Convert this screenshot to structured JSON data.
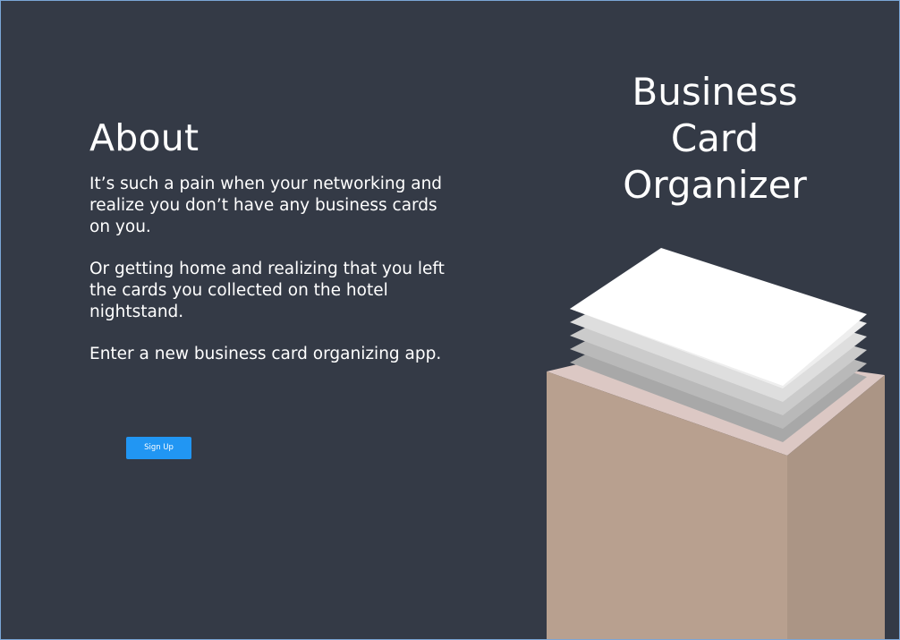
{
  "about": {
    "heading": "About",
    "paragraphs": [
      "It’s such a pain when your networking and realize you don’t have any business cards on you.",
      "Or getting home and realizing that you left the cards you collected on the hotel nightstand.",
      "Enter a new business card organizing app."
    ]
  },
  "actions": {
    "signup_label": "Sign Up"
  },
  "hero": {
    "title_lines": [
      "Business",
      "Card",
      "Organizer"
    ]
  },
  "colors": {
    "background": "#343a46",
    "button": "#2196f3",
    "box_front": "#b8a08f",
    "box_side": "#ab9585",
    "box_top": "#dcc8c4",
    "card_top": "#ffffff"
  }
}
